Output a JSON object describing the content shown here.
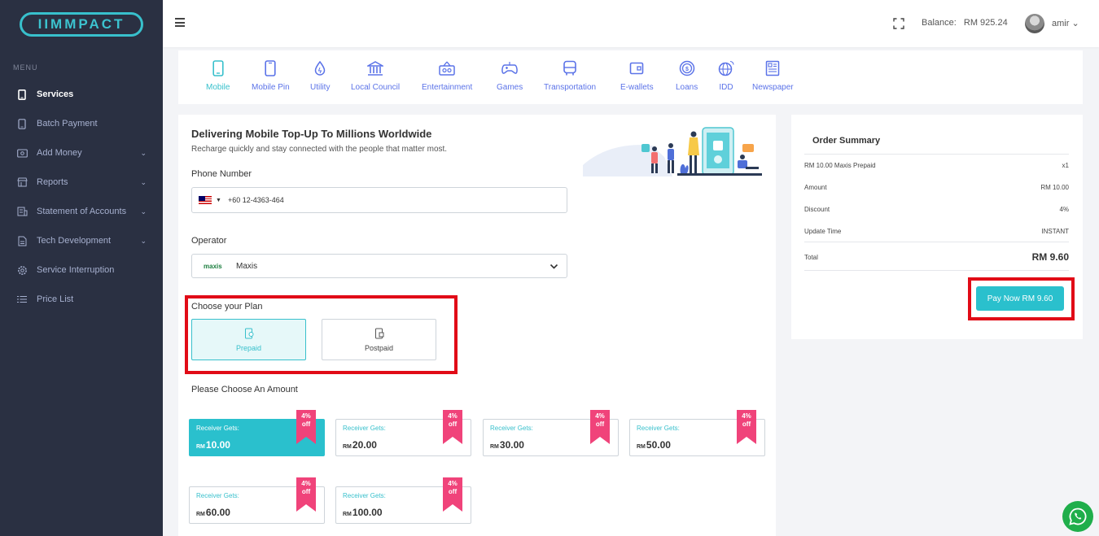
{
  "brand": {
    "logo_text": "IIMMPACT"
  },
  "sidebar": {
    "menu_title": "MENU",
    "items": [
      {
        "label": "Services",
        "icon": "phone-icon",
        "active": true,
        "expandable": false
      },
      {
        "label": "Batch Payment",
        "icon": "phone-icon",
        "active": false,
        "expandable": false
      },
      {
        "label": "Add Money",
        "icon": "wallet-icon",
        "active": false,
        "expandable": true
      },
      {
        "label": "Reports",
        "icon": "store-icon",
        "active": false,
        "expandable": true
      },
      {
        "label": "Statement of Accounts",
        "icon": "statement-icon",
        "active": false,
        "expandable": true
      },
      {
        "label": "Tech Development",
        "icon": "document-icon",
        "active": false,
        "expandable": true
      },
      {
        "label": "Service Interruption",
        "icon": "gear-icon",
        "active": false,
        "expandable": false
      },
      {
        "label": "Price List",
        "icon": "list-icon",
        "active": false,
        "expandable": false
      }
    ]
  },
  "topbar": {
    "balance_label": "Balance:",
    "balance_amount": "RM 925.24",
    "username": "amir",
    "username_chevron": "⌄"
  },
  "categories": [
    {
      "label": "Mobile",
      "icon": "mobile-icon",
      "active": true
    },
    {
      "label": "Mobile Pin",
      "icon": "mobile-pin-icon",
      "active": false
    },
    {
      "label": "Utility",
      "icon": "water-drop-icon",
      "active": false
    },
    {
      "label": "Local Council",
      "icon": "bank-icon",
      "active": false
    },
    {
      "label": "Entertainment",
      "icon": "tv-icon",
      "active": false
    },
    {
      "label": "Games",
      "icon": "gamepad-icon",
      "active": false
    },
    {
      "label": "Transportation",
      "icon": "bus-icon",
      "active": false
    },
    {
      "label": "E-wallets",
      "icon": "wallet-icon",
      "active": false
    },
    {
      "label": "Loans",
      "icon": "coin-icon",
      "active": false
    },
    {
      "label": "IDD",
      "icon": "globe-icon",
      "active": false
    },
    {
      "label": "Newspaper",
      "icon": "newspaper-icon",
      "active": false
    }
  ],
  "main": {
    "headline": "Delivering Mobile Top-Up To Millions Worldwide",
    "subline": "Recharge quickly and stay connected with the people that matter most.",
    "phone_label": "Phone Number",
    "phone_value": "+60 12-4363-464",
    "country_caret": "▼",
    "operator_label": "Operator",
    "operator_logo": "maxis",
    "operator_value": "Maxis",
    "plan_title": "Choose your Plan",
    "plans": [
      {
        "label": "Prepaid",
        "selected": true
      },
      {
        "label": "Postpaid",
        "selected": false
      }
    ],
    "amount_title": "Please Choose An Amount",
    "amounts": [
      {
        "receiver_label": "Receiver Gets:",
        "currency": "RM",
        "value": "10.00",
        "discount_top": "4%",
        "discount_bottom": "off",
        "selected": true
      },
      {
        "receiver_label": "Receiver Gets:",
        "currency": "RM",
        "value": "20.00",
        "discount_top": "4%",
        "discount_bottom": "off",
        "selected": false
      },
      {
        "receiver_label": "Receiver Gets:",
        "currency": "RM",
        "value": "30.00",
        "discount_top": "4%",
        "discount_bottom": "off",
        "selected": false
      },
      {
        "receiver_label": "Receiver Gets:",
        "currency": "RM",
        "value": "50.00",
        "discount_top": "4%",
        "discount_bottom": "off",
        "selected": false
      },
      {
        "receiver_label": "Receiver Gets:",
        "currency": "RM",
        "value": "60.00",
        "discount_top": "4%",
        "discount_bottom": "off",
        "selected": false
      },
      {
        "receiver_label": "Receiver Gets:",
        "currency": "RM",
        "value": "100.00",
        "discount_top": "4%",
        "discount_bottom": "off",
        "selected": false
      }
    ]
  },
  "summary": {
    "title": "Order Summary",
    "rows": [
      {
        "label": "RM 10.00 Maxis Prepaid",
        "value": "x1"
      },
      {
        "label": "Amount",
        "value": "RM 10.00"
      },
      {
        "label": "Discount",
        "value": "4%"
      },
      {
        "label": "Update Time",
        "value": "INSTANT"
      },
      {
        "label": "Total",
        "value": "RM 9.60"
      }
    ],
    "pay_button": "Pay Now RM 9.60"
  },
  "colors": {
    "accent": "#2ac0cd",
    "sidebar_bg": "#2a3042",
    "category_icon": "#5b73e8",
    "discount_ribbon": "#f0437a",
    "highlight_box": "#e10b17",
    "whatsapp": "#1fae4b"
  }
}
